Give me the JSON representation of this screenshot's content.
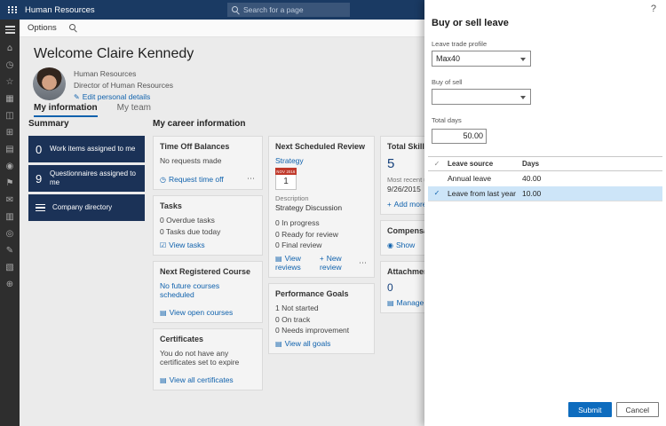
{
  "colors": {
    "topbar": "#1a3a63",
    "sidebar": "#2e2e2e",
    "tile_navy": "#1b3257",
    "accent_link": "#1062ad",
    "row_selection": "#cde5f8",
    "submit_button": "#0e6cbe",
    "calendar_red": "#c0392b"
  },
  "icons": {
    "edit": "✎",
    "clock": "◷",
    "tasks": "☑",
    "book": "▤",
    "certificate": "▤",
    "reviews": "▤",
    "plus": "+",
    "eye": "◉",
    "attach": "▤",
    "more": "⋯",
    "check": "✓"
  },
  "topbar": {
    "app_title": "Human Resources",
    "search_placeholder": "Search for a page"
  },
  "action_bar": {
    "options_label": "Options"
  },
  "sidebar": {
    "icons": [
      {
        "name": "home",
        "glyph": "⌂"
      },
      {
        "name": "recent",
        "glyph": "◷"
      },
      {
        "name": "favorites",
        "glyph": "☆"
      },
      {
        "name": "workspaces",
        "glyph": "▦"
      },
      {
        "name": "modules",
        "glyph": "◫"
      },
      {
        "name": "employees",
        "glyph": "⊞"
      },
      {
        "name": "organization",
        "glyph": "▤"
      },
      {
        "name": "people",
        "glyph": "◉"
      },
      {
        "name": "goals",
        "glyph": "⚑"
      },
      {
        "name": "messages",
        "glyph": "✉"
      },
      {
        "name": "reports",
        "glyph": "▥"
      },
      {
        "name": "compensation",
        "glyph": "◎"
      },
      {
        "name": "worker",
        "glyph": "✎"
      },
      {
        "name": "tasks",
        "glyph": "▧"
      },
      {
        "name": "settings",
        "glyph": "⊕"
      }
    ]
  },
  "main": {
    "welcome": "Welcome Claire Kennedy",
    "profile": {
      "department": "Human Resources",
      "title": "Director of Human Resources",
      "edit_link": "Edit personal details"
    },
    "tabs": [
      "My information",
      "My team"
    ],
    "summary": {
      "heading": "Summary",
      "tiles": [
        {
          "count": "0",
          "label": "Work items assigned to me"
        },
        {
          "count": "9",
          "label": "Questionnaires assigned to me"
        },
        {
          "label": "Company directory"
        }
      ]
    },
    "career": {
      "heading": "My career information",
      "time_off": {
        "title": "Time Off Balances",
        "body": "No requests made",
        "link": "Request time off"
      },
      "tasks": {
        "title": "Tasks",
        "lines": [
          "0 Overdue tasks",
          "0 Tasks due today"
        ],
        "link": "View tasks"
      },
      "course": {
        "title": "Next Registered Course",
        "body": "No future courses scheduled",
        "link": "View open courses"
      },
      "certificates": {
        "title": "Certificates",
        "body": "You do not have any certificates set to expire",
        "link": "View all certificates"
      },
      "review": {
        "title": "Next Scheduled Review",
        "name": "Strategy",
        "cal_month": "NOV 2016",
        "cal_day": "1",
        "desc_label": "Description",
        "desc": "Strategy Discussion",
        "lines": [
          "0 In progress",
          "0 Ready for review",
          "0 Final review"
        ],
        "link_reviews": "View reviews",
        "link_new": "New review"
      },
      "goals": {
        "title": "Performance Goals",
        "lines": [
          "1 Not started",
          "0 On track",
          "0 Needs improvement"
        ],
        "link": "View all goals"
      },
      "skills": {
        "title": "Total Skills",
        "count": "5",
        "updated_label": "Most recent update",
        "date": "9/26/2015",
        "link": "Add more skills"
      },
      "compensation": {
        "title": "Compensation",
        "link": "Show"
      },
      "attachments": {
        "title": "Attachments",
        "count": "0",
        "link": "Manage attachments"
      }
    }
  },
  "panel": {
    "help": "?",
    "title": "Buy or sell leave",
    "leave_trade_profile": {
      "label": "Leave trade profile",
      "value": "Max40"
    },
    "buy_or_sell": {
      "label": "Buy of sell",
      "value": ""
    },
    "total_days": {
      "label": "Total days",
      "value": "50.00"
    },
    "grid": {
      "columns": [
        "Leave source",
        "Days"
      ],
      "rows": [
        {
          "source": "Annual leave",
          "days": "40.00",
          "selected": false
        },
        {
          "source": "Leave from last year",
          "days": "10.00",
          "selected": true
        }
      ]
    },
    "buttons": {
      "submit": "Submit",
      "cancel": "Cancel"
    }
  }
}
